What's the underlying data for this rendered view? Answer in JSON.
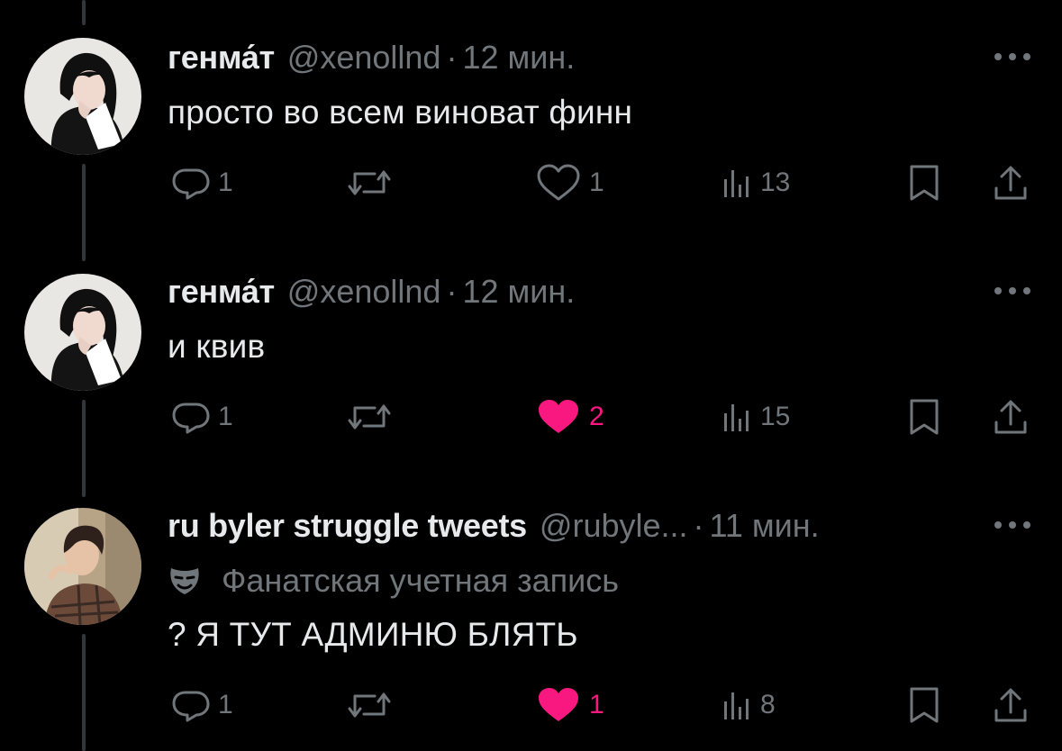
{
  "tweets": [
    {
      "name": "генма́т",
      "handle": "@xenollnd",
      "separator": "·",
      "time": "12 мин.",
      "text": "просто во всем виноват финн",
      "replies": "1",
      "likes": "1",
      "liked": false,
      "views": "13"
    },
    {
      "name": "генма́т",
      "handle": "@xenollnd",
      "separator": "·",
      "time": "12 мин.",
      "text": "и квив",
      "replies": "1",
      "likes": "2",
      "liked": true,
      "views": "15"
    },
    {
      "name": "ru byler struggle tweets",
      "handle": "@rubyle...",
      "separator": "·",
      "time": "11 мин.",
      "badge": "Фанатская учетная запись",
      "text": "? Я ТУТ АДМИНЮ БЛЯТЬ",
      "replies": "1",
      "likes": "1",
      "liked": true,
      "views": "8"
    }
  ],
  "colors": {
    "background": "#000000",
    "text": "#e7e9ea",
    "muted": "#71767b",
    "like": "#f91880",
    "thread_line": "#333639"
  },
  "icons": [
    "reply-icon",
    "retweet-icon",
    "like-icon",
    "views-icon",
    "bookmark-icon",
    "share-icon",
    "more-icon",
    "mask-icon"
  ]
}
